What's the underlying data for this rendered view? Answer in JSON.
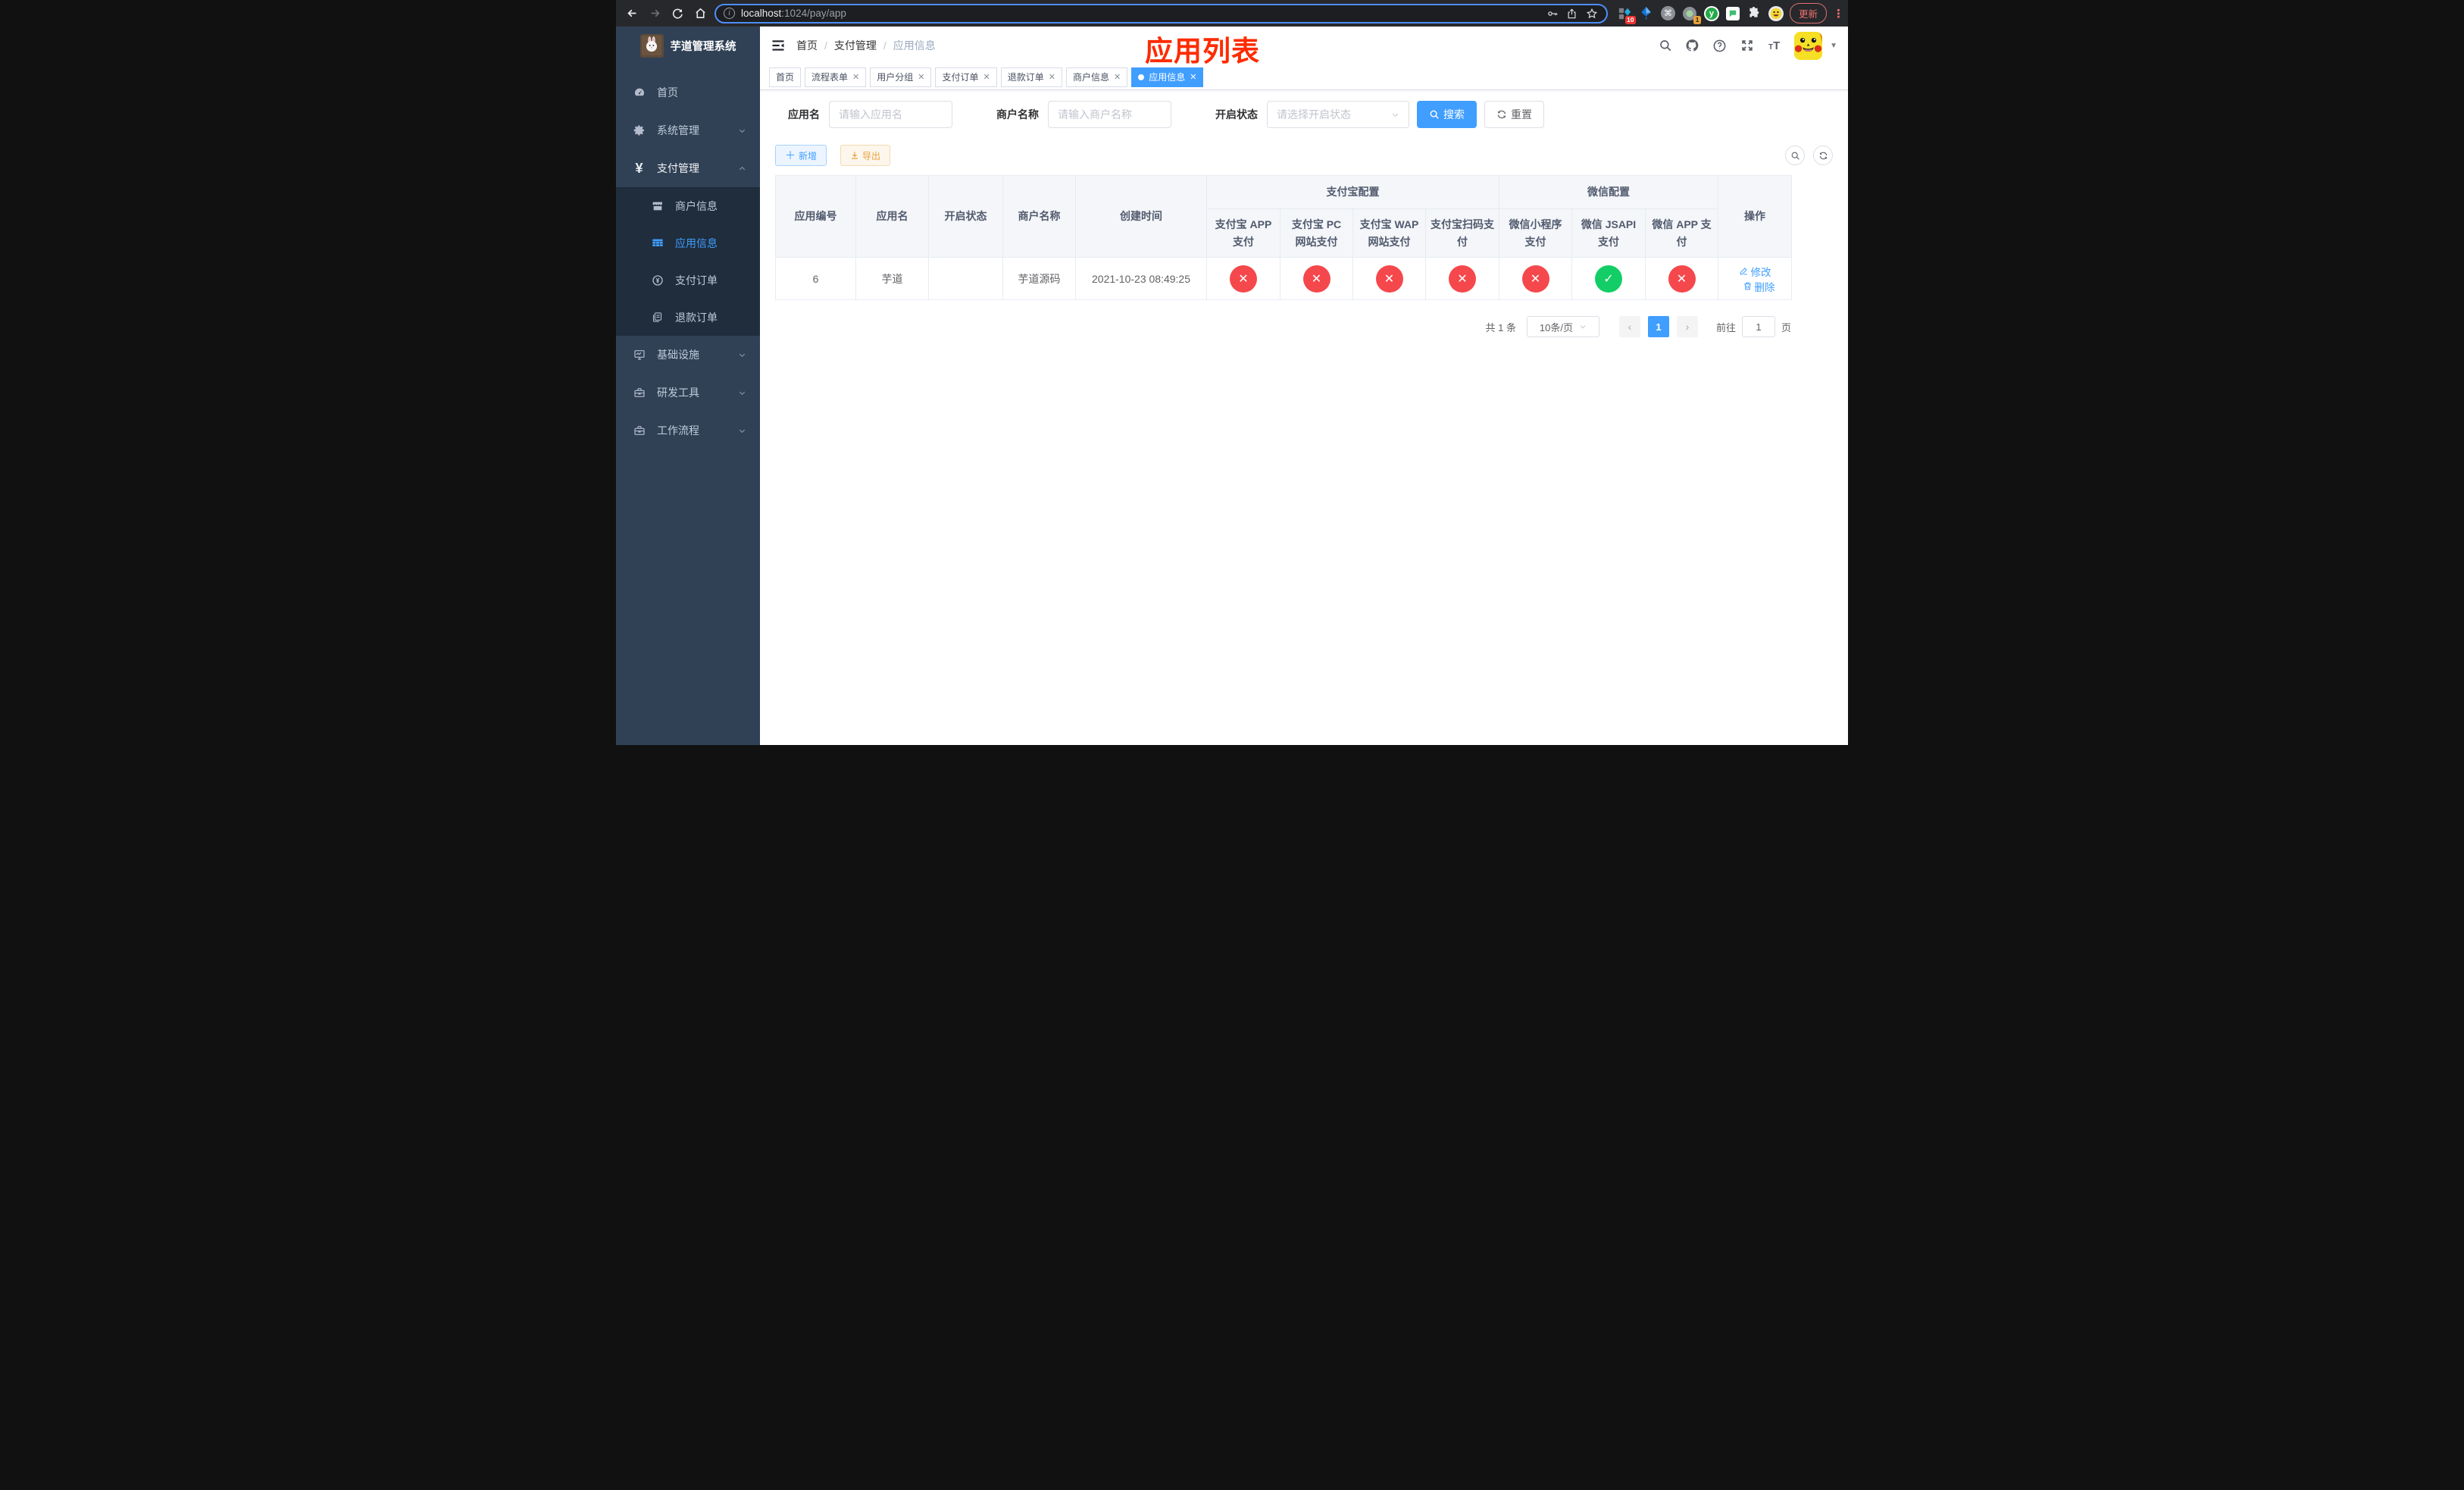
{
  "colors": {
    "accent": "#409eff",
    "danger": "#f5484c",
    "success": "#13ce66",
    "sidebar_bg": "#304156",
    "submenu_bg": "#1f2d3d"
  },
  "browser": {
    "url": {
      "host": "localhost",
      "rest": ":1024/pay/app"
    },
    "update_label": "更新",
    "ext_badge_tiles": "10",
    "ext_badge_record": "1",
    "green_ext_letter": "y"
  },
  "sidebar": {
    "title": "芋道管理系统",
    "items": [
      {
        "label": "首页"
      },
      {
        "label": "系统管理"
      },
      {
        "label": "支付管理"
      },
      {
        "label": "商户信息"
      },
      {
        "label": "应用信息"
      },
      {
        "label": "支付订单"
      },
      {
        "label": "退款订单"
      },
      {
        "label": "基础设施"
      },
      {
        "label": "研发工具"
      },
      {
        "label": "工作流程"
      }
    ]
  },
  "header": {
    "breadcrumb": [
      "首页",
      "支付管理",
      "应用信息"
    ],
    "annotation": "应用列表"
  },
  "tabs": [
    {
      "label": "首页"
    },
    {
      "label": "流程表单"
    },
    {
      "label": "用户分组"
    },
    {
      "label": "支付订单"
    },
    {
      "label": "退款订单"
    },
    {
      "label": "商户信息"
    },
    {
      "label": "应用信息"
    }
  ],
  "filters": {
    "app_name_label": "应用名",
    "app_name_placeholder": "请输入应用名",
    "merchant_label": "商户名称",
    "merchant_placeholder": "请输入商户名称",
    "status_label": "开启状态",
    "status_placeholder": "请选择开启状态",
    "search_label": "搜索",
    "reset_label": "重置"
  },
  "toolbar": {
    "add_label": "新增",
    "export_label": "导出"
  },
  "table": {
    "columns": {
      "app_id": "应用编号",
      "app_name": "应用名",
      "status": "开启状态",
      "merchant": "商户名称",
      "created": "创建时间",
      "alipay_group": "支付宝配置",
      "wechat_group": "微信配置",
      "alipay_app": "支付宝 APP 支付",
      "alipay_pc": "支付宝 PC 网站支付",
      "alipay_wap": "支付宝 WAP 网站支付",
      "alipay_qr": "支付宝扫码支付",
      "wx_lite": "微信小程序支付",
      "wx_jsapi": "微信 JSAPI 支付",
      "wx_app": "微信 APP 支付",
      "actions": "操作"
    },
    "row": {
      "app_id": "6",
      "app_name": "芋道",
      "switch_state": "on",
      "merchant": "芋道源码",
      "created": "2021-10-23 08:49:25",
      "statuses": [
        {
          "state": "no",
          "glyph": "✕"
        },
        {
          "state": "no",
          "glyph": "✕"
        },
        {
          "state": "no",
          "glyph": "✕"
        },
        {
          "state": "no",
          "glyph": "✕"
        },
        {
          "state": "no",
          "glyph": "✕"
        },
        {
          "state": "yes",
          "glyph": "✓"
        },
        {
          "state": "no",
          "glyph": "✕"
        }
      ],
      "edit_label": "修改",
      "delete_label": "删除"
    }
  },
  "pagination": {
    "total": "共 1 条",
    "page_size": "10条/页",
    "page": "1",
    "goto_label": "前往",
    "goto_value": "1",
    "page_unit": "页"
  }
}
